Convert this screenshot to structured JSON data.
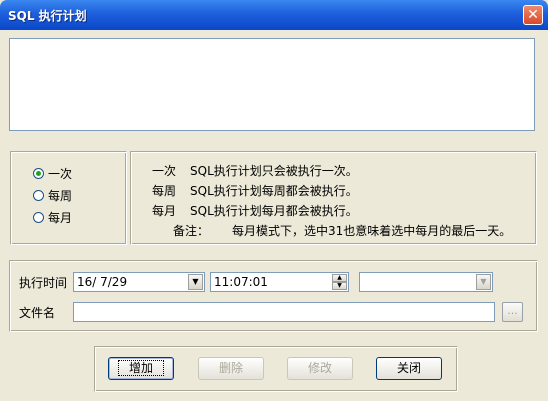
{
  "window": {
    "title": "SQL 执行计划"
  },
  "schedule": {
    "options": [
      {
        "label": "一次",
        "checked": true
      },
      {
        "label": "每周",
        "checked": false
      },
      {
        "label": "每月",
        "checked": false
      }
    ]
  },
  "info": {
    "lines": [
      {
        "key": "一次",
        "text": "SQL执行计划只会被执行一次。"
      },
      {
        "key": "每周",
        "text": "SQL执行计划每周都会被执行。"
      },
      {
        "key": "每月",
        "text": "SQL执行计划每月都会被执行。"
      }
    ],
    "note_key": "备注：",
    "note_text": "每月模式下，选中31也意味着选中每月的最后一天。"
  },
  "form": {
    "time_label": "执行时间",
    "date_value": "16/ 7/29",
    "time_value": "11:07:01",
    "weekday_value": "",
    "file_label": "文件名",
    "file_value": "",
    "browse_label": "..."
  },
  "buttons": {
    "add": "增加",
    "delete": "删除",
    "modify": "修改",
    "close": "关闭"
  },
  "icons": {
    "close": "close-icon",
    "dropdown": "chevron-down-icon"
  },
  "colors": {
    "titlebar": "#0a47c8",
    "close": "#d9482a",
    "face": "#ece9d8"
  }
}
